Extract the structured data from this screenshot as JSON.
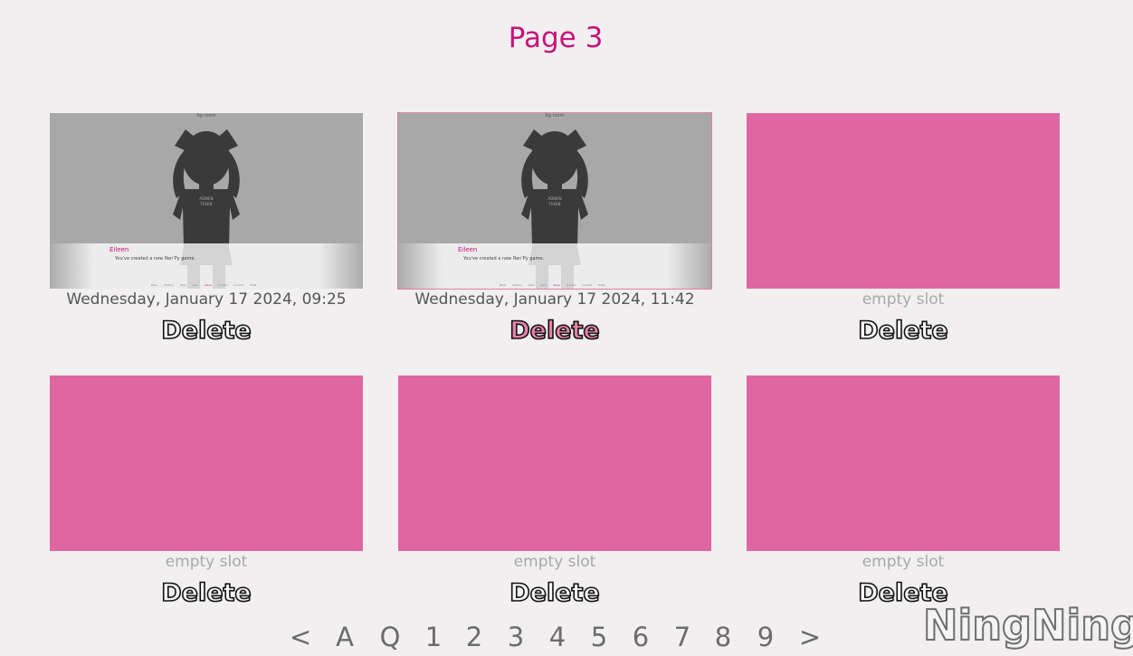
{
  "title": "Page 3",
  "slots": [
    {
      "empty": false,
      "selected": false,
      "time": "Wednesday, January 17 2024, 09:25",
      "thumb": {
        "caption": "bg room",
        "shirt_text": [
          "ADWEN",
          "ThEEN"
        ],
        "speaker": "Eileen",
        "dialogue": "You've created a new Ren'Py game.",
        "menu": [
          "Back",
          "History",
          "Skip",
          "Auto",
          "Save",
          "Q.Save",
          "Q.Load",
          "Prefs"
        ],
        "menu_active": "Save"
      },
      "delete_label": "Delete"
    },
    {
      "empty": false,
      "selected": true,
      "time": "Wednesday, January 17 2024, 11:42",
      "thumb": {
        "caption": "bg room",
        "shirt_text": [
          "ADWEN",
          "ThEEN"
        ],
        "speaker": "Eileen",
        "dialogue": "You've created a new Ren'Py game.",
        "menu": [
          "Back",
          "History",
          "Skip",
          "Auto",
          "Save",
          "Q.Save",
          "Q.Load",
          "Prefs"
        ],
        "menu_active": "Save"
      },
      "delete_label": "Delete"
    },
    {
      "empty": true,
      "time": "empty slot",
      "delete_label": "Delete"
    },
    {
      "empty": true,
      "time": "empty slot",
      "delete_label": "Delete"
    },
    {
      "empty": true,
      "time": "empty slot",
      "delete_label": "Delete"
    },
    {
      "empty": true,
      "time": "empty slot",
      "delete_label": "Delete"
    }
  ],
  "pager": {
    "prev": "<",
    "auto": "A",
    "quick": "Q",
    "pages": [
      "1",
      "2",
      "3",
      "4",
      "5",
      "6",
      "7",
      "8",
      "9"
    ],
    "next": ">"
  },
  "watermark": "NingNing",
  "colors": {
    "accent": "#c8127a",
    "empty_slot": "#e066a2",
    "background": "#f1eff0",
    "hover_delete": "#e883aa"
  }
}
